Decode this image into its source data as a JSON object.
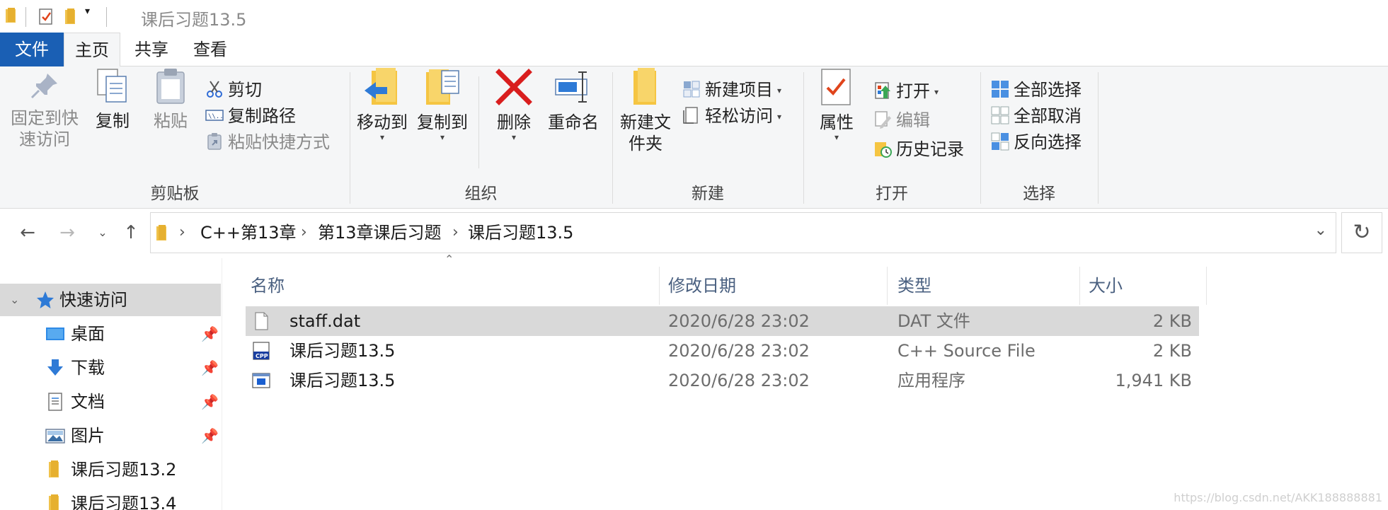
{
  "window": {
    "title": "课后习题13.5"
  },
  "ribbon_tabs": [
    {
      "label": "文件"
    },
    {
      "label": "主页"
    },
    {
      "label": "共享"
    },
    {
      "label": "查看"
    }
  ],
  "clipboard": {
    "pin_label": "固定到快速访问",
    "copy_label": "复制",
    "paste_label": "粘贴",
    "cut_label": "剪切",
    "copy_path_label": "复制路径",
    "paste_shortcut_label": "粘贴快捷方式",
    "group_label": "剪贴板"
  },
  "organize": {
    "move_to_label": "移动到",
    "copy_to_label": "复制到",
    "delete_label": "删除",
    "rename_label": "重命名",
    "group_label": "组织"
  },
  "new": {
    "new_folder_label": "新建文件夹",
    "new_item_label": "新建项目",
    "easy_access_label": "轻松访问",
    "group_label": "新建"
  },
  "open": {
    "properties_label": "属性",
    "open_label": "打开",
    "edit_label": "编辑",
    "history_label": "历史记录",
    "group_label": "打开"
  },
  "select": {
    "select_all_label": "全部选择",
    "select_none_label": "全部取消",
    "invert_label": "反向选择",
    "group_label": "选择"
  },
  "address": {
    "crumbs": [
      "C++第13章",
      "第13章课后习题",
      "课后习题13.5"
    ]
  },
  "nav_pane": {
    "quick_access_label": "快速访问",
    "items": [
      {
        "label": "桌面",
        "icon": "desktop-icon"
      },
      {
        "label": "下载",
        "icon": "download-icon"
      },
      {
        "label": "文档",
        "icon": "document-icon"
      },
      {
        "label": "图片",
        "icon": "picture-icon"
      },
      {
        "label": "课后习题13.2",
        "icon": "folder-icon"
      },
      {
        "label": "课后习题13.4",
        "icon": "folder-icon"
      }
    ]
  },
  "columns": {
    "name": "名称",
    "modified": "修改日期",
    "type": "类型",
    "size": "大小"
  },
  "files": [
    {
      "name": "staff.dat",
      "modified": "2020/6/28 23:02",
      "type": "DAT 文件",
      "size": "2 KB",
      "icon": "file-icon",
      "selected": true
    },
    {
      "name": "课后习题13.5",
      "modified": "2020/6/28 23:02",
      "type": "C++ Source File",
      "size": "2 KB",
      "icon": "cpp-file-icon",
      "selected": false
    },
    {
      "name": "课后习题13.5",
      "modified": "2020/6/28 23:02",
      "type": "应用程序",
      "size": "1,941 KB",
      "icon": "exe-icon",
      "selected": false
    }
  ],
  "watermark": "https://blog.csdn.net/AKK188888881",
  "colors": {
    "file_tab": "#1a5fb4",
    "ribbon_bg": "#f5f6f7",
    "selection": "#d9d9d9",
    "folder_yellow": "#f5c542"
  }
}
